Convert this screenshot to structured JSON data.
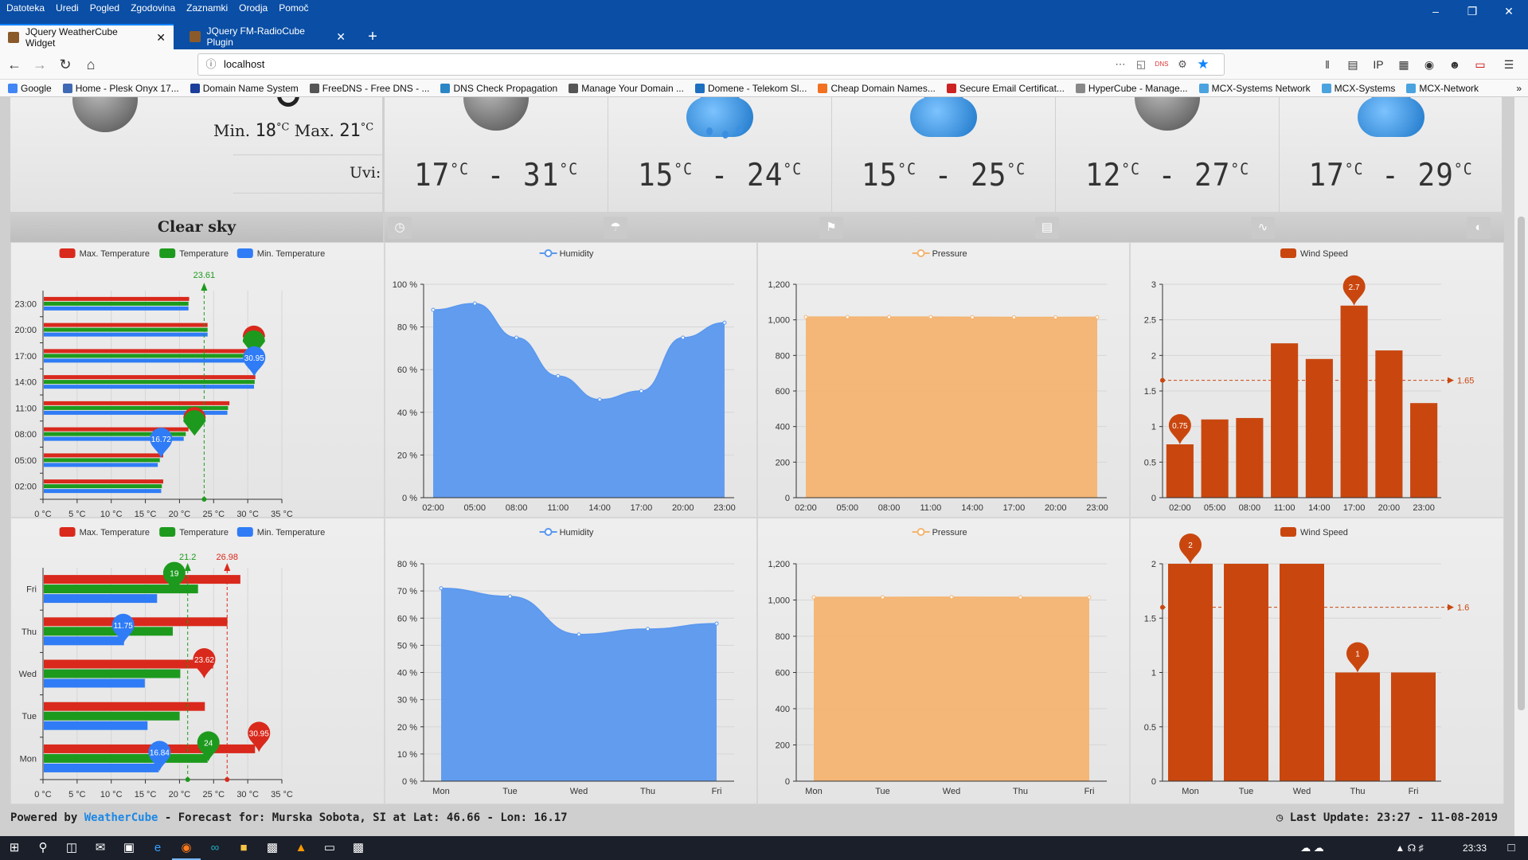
{
  "menu": [
    "Datoteka",
    "Uredi",
    "Pogled",
    "Zgodovina",
    "Zaznamki",
    "Orodja",
    "Pomoč"
  ],
  "tabs": [
    {
      "label": "JQuery WeatherCube Widget",
      "active": true
    },
    {
      "label": "JQuery FM-RadioCube Plugin",
      "active": false
    }
  ],
  "url": "localhost",
  "bookmarks": [
    {
      "label": "Google",
      "color": "#4285f4"
    },
    {
      "label": "Home - Plesk Onyx 17...",
      "color": "#3f6ab3"
    },
    {
      "label": "Domain Name System",
      "color": "#1a3e99"
    },
    {
      "label": "FreeDNS - Free DNS - ...",
      "color": "#555555"
    },
    {
      "label": "DNS Check Propagation",
      "color": "#2b86c5"
    },
    {
      "label": "Manage Your Domain ...",
      "color": "#555555"
    },
    {
      "label": "Domene - Telekom Sl...",
      "color": "#1d6fc0"
    },
    {
      "label": "Cheap Domain Names...",
      "color": "#f37021"
    },
    {
      "label": "Secure Email Certificat...",
      "color": "#cc2222"
    },
    {
      "label": "HyperCube - Manage...",
      "color": "#888888"
    },
    {
      "label": "MCX-Systems Network",
      "color": "#4aa3df"
    },
    {
      "label": "MCX-Systems",
      "color": "#4aa3df"
    },
    {
      "label": "MCX-Network",
      "color": "#4aa3df"
    }
  ],
  "today": {
    "min_label": "Min.",
    "min_value": "18",
    "max_label": "Max.",
    "max_value": "21",
    "unit": "°C",
    "uvi_label": "Uvi:",
    "condition": "Clear sky"
  },
  "forecast_days": [
    {
      "temp_min": "17",
      "temp_max": "31",
      "icon": "moon-icon"
    },
    {
      "temp_min": "15",
      "temp_max": "24",
      "icon": "rain-cloud-icon"
    },
    {
      "temp_min": "15",
      "temp_max": "25",
      "icon": "cloud-icon"
    },
    {
      "temp_min": "12",
      "temp_max": "27",
      "icon": "moon-icon"
    },
    {
      "temp_min": "17",
      "temp_max": "29",
      "icon": "cloud-icon"
    }
  ],
  "toolbar_icons": [
    "clock-icon",
    "umbrella-icon",
    "flag-icon",
    "sim-icon",
    "pulse-icon",
    "contrast-icon"
  ],
  "legend": {
    "max_temp": "Max. Temperature",
    "temp": "Temperature",
    "min_temp": "Min. Temperature",
    "humidity": "Humidity",
    "pressure": "Pressure",
    "wind": "Wind Speed"
  },
  "colors": {
    "max": "#d9291c",
    "temp": "#1d9a1d",
    "min": "#2f7cf6",
    "humidity": "#5b98ee",
    "pressure": "#f4b471",
    "wind": "#c9470f"
  },
  "chart_data": [
    {
      "type": "bar",
      "orientation": "horizontal",
      "id": "hourly-temperature",
      "categories": [
        "02:00",
        "05:00",
        "08:00",
        "11:00",
        "14:00",
        "17:00",
        "20:00",
        "23:00"
      ],
      "series": [
        {
          "name": "Max. Temperature",
          "values": [
            17.5,
            17.5,
            21.2,
            27.2,
            31.0,
            30.5,
            24.0,
            21.3
          ]
        },
        {
          "name": "Temperature",
          "values": [
            17.3,
            17.0,
            20.8,
            27.0,
            30.9,
            30.5,
            24.0,
            21.2
          ]
        },
        {
          "name": "Min. Temperature",
          "values": [
            17.2,
            16.7,
            20.5,
            26.9,
            30.8,
            30.3,
            24.0,
            21.2
          ]
        }
      ],
      "markers": [
        {
          "label": "16.72",
          "series": "Min. Temperature"
        },
        {
          "label": "30.95",
          "series": "Min. Temperature"
        }
      ],
      "average_line": {
        "label": "23.61",
        "value": 23.61
      },
      "xticks": [
        "0 °C",
        "5 °C",
        "10 °C",
        "15 °C",
        "20 °C",
        "25 °C",
        "30 °C",
        "35 °C"
      ],
      "xlim": [
        0,
        35
      ]
    },
    {
      "type": "area",
      "id": "hourly-humidity",
      "categories": [
        "02:00",
        "05:00",
        "08:00",
        "11:00",
        "14:00",
        "17:00",
        "20:00",
        "23:00"
      ],
      "series": [
        {
          "name": "Humidity",
          "values": [
            88,
            91,
            75,
            57,
            46,
            50,
            75,
            82
          ]
        }
      ],
      "yticks": [
        "0 %",
        "20 %",
        "40 %",
        "60 %",
        "80 %",
        "100 %"
      ],
      "ylim": [
        0,
        100
      ]
    },
    {
      "type": "area",
      "id": "hourly-pressure",
      "categories": [
        "02:00",
        "05:00",
        "08:00",
        "11:00",
        "14:00",
        "17:00",
        "20:00",
        "23:00"
      ],
      "series": [
        {
          "name": "Pressure",
          "values": [
            1016,
            1016,
            1016,
            1016,
            1015,
            1014,
            1014,
            1015
          ]
        }
      ],
      "yticks": [
        "0",
        "200",
        "400",
        "600",
        "800",
        "1,000",
        "1,200"
      ],
      "ylim": [
        0,
        1200
      ]
    },
    {
      "type": "bar",
      "id": "hourly-wind",
      "categories": [
        "02:00",
        "05:00",
        "08:00",
        "11:00",
        "14:00",
        "17:00",
        "20:00",
        "23:00"
      ],
      "series": [
        {
          "name": "Wind Speed",
          "values": [
            0.75,
            1.1,
            1.12,
            2.17,
            1.95,
            2.7,
            2.07,
            1.33
          ]
        }
      ],
      "markers": [
        {
          "label": "0.75",
          "index": 0
        },
        {
          "label": "2.7",
          "index": 5
        }
      ],
      "average_line": {
        "label": "1.65",
        "value": 1.65
      },
      "yticks": [
        "0",
        "0.5",
        "1",
        "1.5",
        "2",
        "2.5",
        "3"
      ],
      "ylim": [
        0,
        3
      ]
    },
    {
      "type": "bar",
      "orientation": "horizontal",
      "id": "daily-temperature",
      "categories": [
        "Mon",
        "Tue",
        "Wed",
        "Thu",
        "Fri"
      ],
      "series": [
        {
          "name": "Max. Temperature",
          "values": [
            30.95,
            23.6,
            24.8,
            26.9,
            28.8
          ]
        },
        {
          "name": "Temperature",
          "values": [
            24.0,
            19.9,
            20.0,
            18.9,
            22.6
          ]
        },
        {
          "name": "Min. Temperature",
          "values": [
            16.84,
            15.2,
            14.8,
            11.75,
            16.6
          ]
        }
      ],
      "markers": [
        {
          "label": "30.95"
        },
        {
          "label": "24"
        },
        {
          "label": "16.84"
        },
        {
          "label": "23.62"
        },
        {
          "label": "11.75"
        },
        {
          "label": "19"
        }
      ],
      "average_lines": [
        {
          "label": "21.2",
          "value": 21.2
        },
        {
          "label": "26.98",
          "value": 26.98
        }
      ],
      "xticks": [
        "0 °C",
        "5 °C",
        "10 °C",
        "15 °C",
        "20 °C",
        "25 °C",
        "30 °C",
        "35 °C"
      ],
      "xlim": [
        0,
        35
      ]
    },
    {
      "type": "area",
      "id": "daily-humidity",
      "categories": [
        "Mon",
        "Tue",
        "Wed",
        "Thu",
        "Fri"
      ],
      "series": [
        {
          "name": "Humidity",
          "values": [
            71,
            68,
            54,
            56,
            58
          ]
        }
      ],
      "yticks": [
        "0 %",
        "10 %",
        "20 %",
        "30 %",
        "40 %",
        "50 %",
        "60 %",
        "70 %",
        "80 %"
      ],
      "ylim": [
        0,
        80
      ]
    },
    {
      "type": "area",
      "id": "daily-pressure",
      "categories": [
        "Mon",
        "Tue",
        "Wed",
        "Thu",
        "Fri"
      ],
      "series": [
        {
          "name": "Pressure",
          "values": [
            1015,
            1015,
            1016,
            1015,
            1015
          ]
        }
      ],
      "yticks": [
        "0",
        "200",
        "400",
        "600",
        "800",
        "1,000",
        "1,200"
      ],
      "ylim": [
        0,
        1200
      ]
    },
    {
      "type": "bar",
      "id": "daily-wind",
      "categories": [
        "Mon",
        "Tue",
        "Wed",
        "Thu",
        "Fri"
      ],
      "series": [
        {
          "name": "Wind Speed",
          "values": [
            2,
            2,
            2,
            1,
            1
          ]
        }
      ],
      "markers": [
        {
          "label": "2",
          "index": 0
        },
        {
          "label": "1",
          "index": 3
        }
      ],
      "average_line": {
        "label": "1.6",
        "value": 1.6
      },
      "yticks": [
        "0",
        "0.5",
        "1",
        "1.5",
        "2"
      ],
      "ylim": [
        0,
        2
      ]
    }
  ],
  "footer": {
    "powered": "Powered by",
    "brand": "WeatherCube",
    "forecast": "- Forecast for: Murska Sobota, SI at Lat: 46.66 - Lon: 16.17",
    "update": "Last Update: 23:27 - 11-08-2019"
  },
  "taskbar": {
    "time": "23:33"
  }
}
